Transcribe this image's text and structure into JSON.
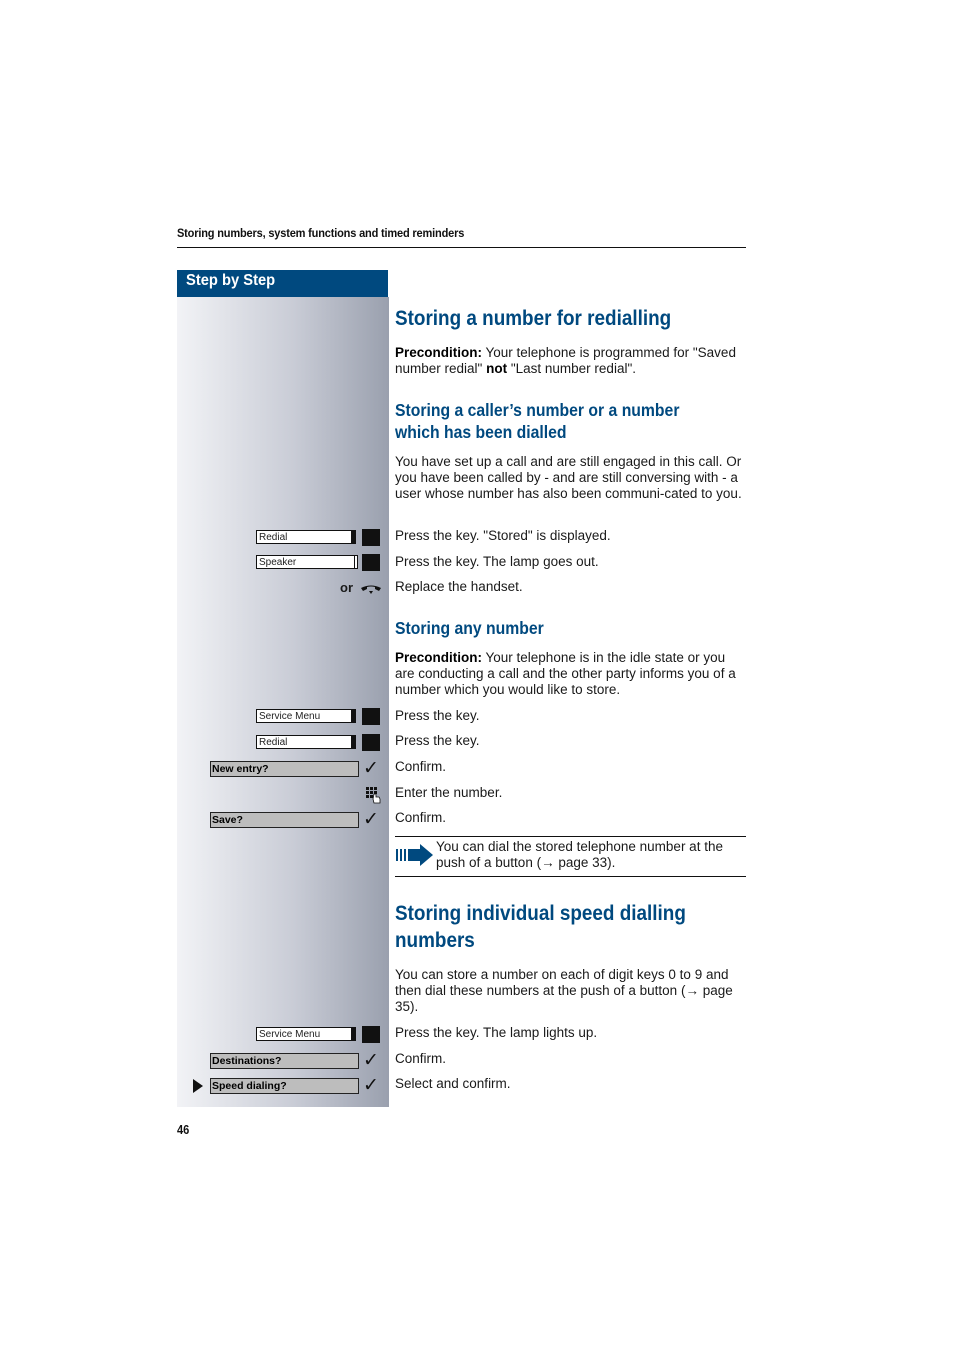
{
  "running_head": "Storing numbers, system functions and timed reminders",
  "sidebar_title": "Step by Step",
  "page_number": "46",
  "sections": {
    "s1": {
      "title": "Storing a number for redialling",
      "precondition_label": "Precondition:",
      "precondition_text_1": " Your telephone is programmed for \"Saved number redial\" ",
      "precondition_bold": "not",
      "precondition_text_2": " \"Last number redial\"."
    },
    "s2": {
      "title": "Storing a caller’s number or a number which has been dialled",
      "intro": "You have set up a call and are still engaged in this call. Or you have been called by - and are still conversing with - a user whose number has also been communi-cated to you.",
      "steps": [
        {
          "key": "Redial",
          "text": "Press the key. \"Stored\" is displayed."
        },
        {
          "key": "Speaker",
          "text": "Press the key. The lamp goes out."
        },
        {
          "or_label": "or",
          "icon": "handset-down-icon",
          "text": "Replace the handset."
        }
      ]
    },
    "s3": {
      "title": "Storing any number",
      "precondition_label": "Precondition:",
      "precondition_text": " Your telephone is in the idle state or you are conducting a call and the other party informs you of a number which you would like to store.",
      "steps": [
        {
          "key": "Service Menu",
          "text": "Press the key."
        },
        {
          "key": "Redial",
          "text": "Press the key."
        },
        {
          "display": "New entry?",
          "text": "Confirm."
        },
        {
          "icon": "keypad-icon",
          "text": "Enter the number."
        },
        {
          "display": "Save?",
          "text": "Confirm."
        }
      ],
      "tip": "You can dial the stored telephone number at the push of a button (→ page 33)."
    },
    "s4": {
      "title": "Storing individual speed dialling numbers",
      "intro": "You can store a number on each of digit keys 0 to 9 and then dial these numbers at the push of a button (→ page 35).",
      "steps": [
        {
          "key": "Service Menu",
          "text": "Press the key. The lamp lights up."
        },
        {
          "display": "Destinations?",
          "text": "Confirm."
        },
        {
          "display": "Speed dialing?",
          "text": "Select and confirm."
        }
      ]
    }
  },
  "check_glyph": "✓",
  "colors": {
    "brand_blue": "#00497f"
  }
}
